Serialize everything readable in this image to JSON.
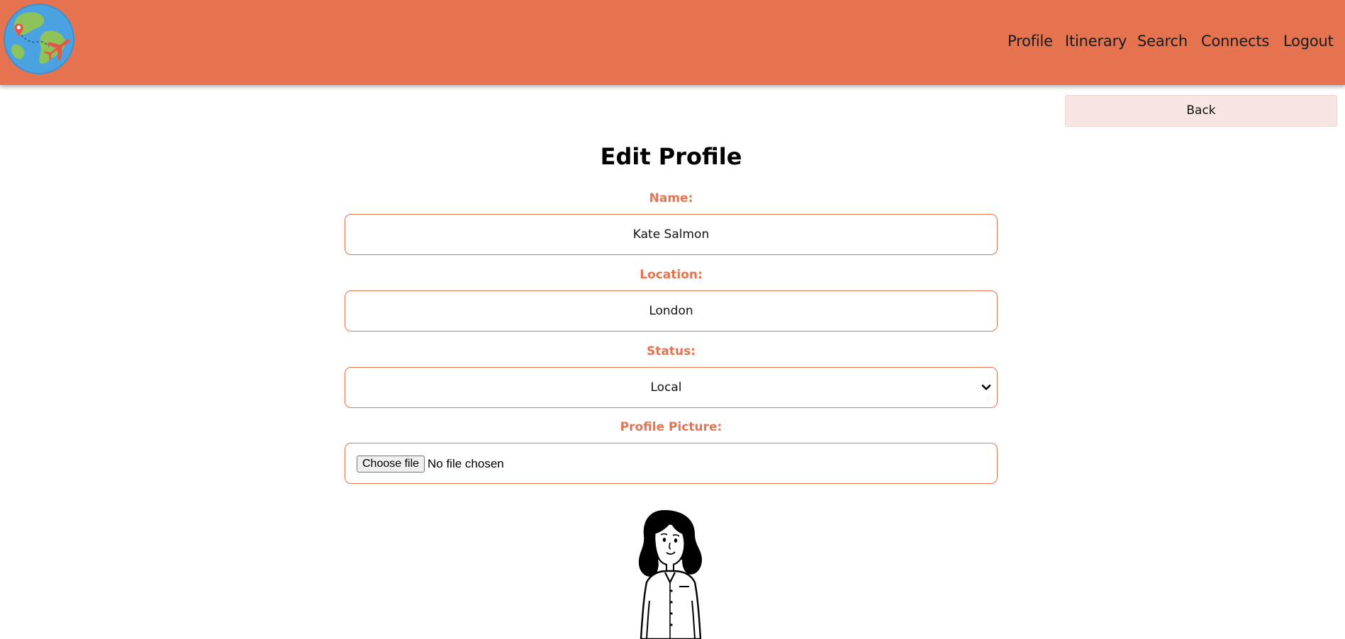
{
  "brand": {
    "logo_icon": "globe-airplane-icon",
    "header_color": "#e6734f"
  },
  "nav": {
    "items": [
      {
        "label": "Profile"
      },
      {
        "label": "Itinerary"
      },
      {
        "label": "Search"
      },
      {
        "label": "Connects"
      },
      {
        "label": "Logout"
      }
    ]
  },
  "back_button": {
    "label": "Back"
  },
  "page": {
    "title": "Edit Profile"
  },
  "form": {
    "name": {
      "label": "Name:",
      "value": "Kate Salmon"
    },
    "location": {
      "label": "Location:",
      "value": "London"
    },
    "status": {
      "label": "Status:",
      "selected": "Local",
      "icon": "chevron-down-icon"
    },
    "picture": {
      "label": "Profile Picture:",
      "button_label": "Choose file",
      "file_text": "No file chosen"
    }
  },
  "avatar": {
    "icon": "woman-illustration"
  },
  "colors": {
    "accent": "#e6734f",
    "back_button_bg": "#f6e5e2"
  }
}
